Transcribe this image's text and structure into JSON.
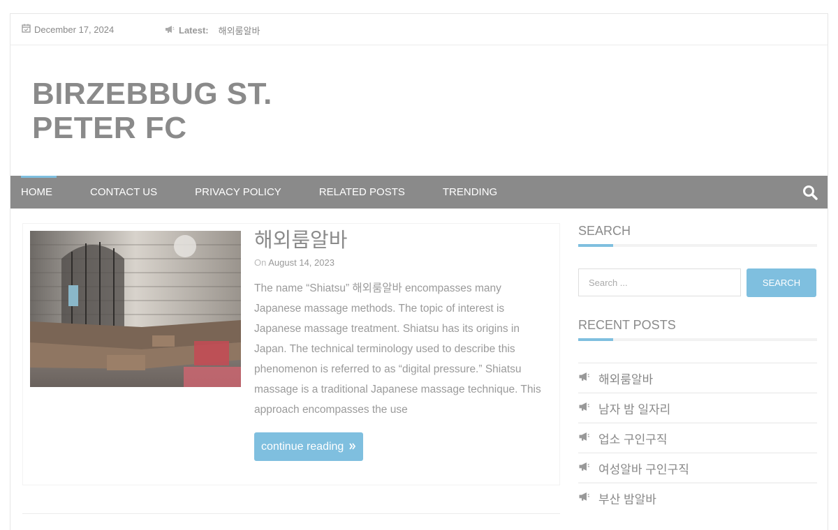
{
  "topbar": {
    "date": "December 17, 2024",
    "latest_label": "Latest:",
    "latest_text": "해외룸알바",
    "icons": {
      "date": "calendar-icon",
      "latest": "megaphone-icon"
    }
  },
  "site": {
    "title_line1": "BIRZEBBUG ST.",
    "title_line2": "PETER FC"
  },
  "nav": {
    "items": [
      "HOME",
      "CONTACT US",
      "PRIVACY POLICY",
      "RELATED POSTS",
      "TRENDING"
    ],
    "active": "HOME",
    "search_icon": "search-icon"
  },
  "post": {
    "title": "해외룸알바",
    "meta_prefix": "On",
    "date": "August 14, 2023",
    "excerpt": "The name “Shiatsu” 해외룸알바 encompasses many Japanese massage methods. The topic of interest is Japanese massage treatment. Shiatsu has its origins in Japan. The technical terminology used to describe this phenomenon is referred to as “digital pressure.” Shiatsu massage is a traditional Japanese massage technique. This approach encompasses the use",
    "continue_label": "continue reading",
    "continue_icon": "double-chevron-right-icon"
  },
  "sidebar": {
    "search_title": "SEARCH",
    "search_placeholder": "Search ...",
    "search_button": "SEARCH",
    "recent_title": "RECENT POSTS",
    "recent_posts": [
      "해외룸알바",
      "남자 밤 일자리",
      "업소 구인구직",
      "여성알바 구인구직",
      "부산 밤알바"
    ]
  },
  "colors": {
    "accent": "#7fbfdf",
    "nav_bg": "#8a8a8a",
    "title": "#8a8a8a"
  }
}
